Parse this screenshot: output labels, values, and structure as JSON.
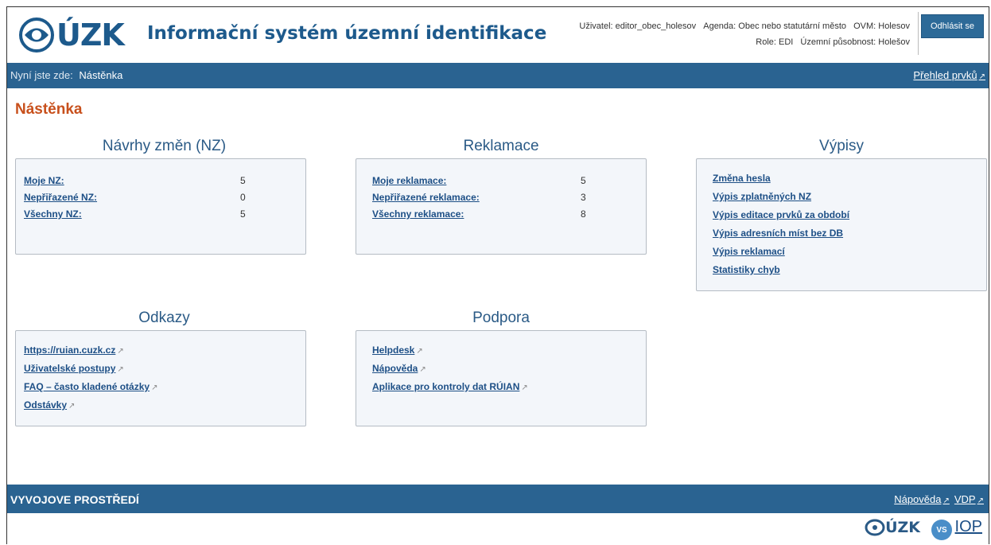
{
  "header": {
    "logo_text": "ÚZK",
    "app_title": "Informační systém územní identifikace",
    "user": "Uživatel: editor_obec_holesov",
    "agenda": "Agenda: Obec nebo statutární město",
    "ovm": "OVM: Holesov",
    "role": "Role: EDI",
    "scope": "Územní působnost: Holešov",
    "logout_label": "Odhlásit se"
  },
  "nav": {
    "breadcrumb_label": "Nyní jste zde:",
    "breadcrumb_current": "Nástěnka",
    "overview_link": "Přehled prvků"
  },
  "page_title": "Nástěnka",
  "sections": {
    "nz": {
      "title": "Návrhy změn (NZ)",
      "rows": [
        {
          "label": "Moje NZ:",
          "value": "5"
        },
        {
          "label": "Nepřiřazené NZ:",
          "value": "0"
        },
        {
          "label": "Všechny NZ:",
          "value": "5"
        }
      ]
    },
    "reklamace": {
      "title": "Reklamace",
      "rows": [
        {
          "label": "Moje reklamace:",
          "value": "5"
        },
        {
          "label": "Nepřiřazené reklamace:",
          "value": "3"
        },
        {
          "label": "Všechny reklamace:",
          "value": "8"
        }
      ]
    },
    "vypisy": {
      "title": "Výpisy",
      "links": [
        "Změna hesla",
        "Výpis zplatněných NZ",
        "Výpis editace prvků za období",
        "Výpis adresních míst bez DB",
        "Výpis reklamací",
        "Statistiky chyb"
      ]
    },
    "odkazy": {
      "title": "Odkazy",
      "links": [
        "https://ruian.cuzk.cz",
        "Uživatelské postupy",
        "FAQ – často kladené otázky",
        "Odstávky"
      ]
    },
    "podpora": {
      "title": "Podpora",
      "links": [
        "Helpdesk",
        "Nápověda",
        "Aplikace pro kontroly dat RÚIAN"
      ]
    }
  },
  "footer": {
    "environment": "VYVOJOVE PROSTŘEDÍ",
    "help_link": "Nápověda",
    "vdp_link": "VDP",
    "bottom_logo_text": "ÚZK",
    "iop_badge": "VS",
    "iop_link": "IOP"
  },
  "icons": {
    "external_link": "external-link-icon",
    "logo": "cuzk-logo-icon"
  }
}
